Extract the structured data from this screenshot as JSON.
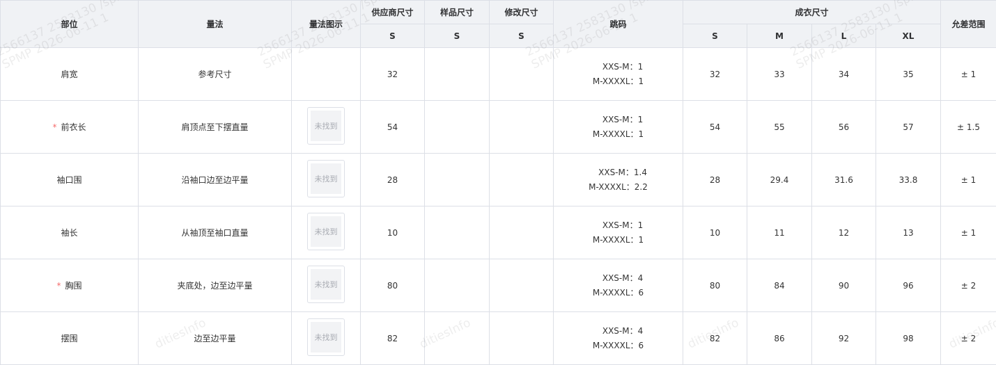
{
  "header": {
    "part": "部位",
    "method": "量法",
    "diagram": "量法图示",
    "supplier_size": "供应商尺寸",
    "sample_size": "样品尺寸",
    "modified_size": "修改尺寸",
    "supplier_sub": "S",
    "sample_sub": "S",
    "modified_sub": "S",
    "jump": "跳码",
    "garment_size": "成衣尺寸",
    "sizes": [
      "S",
      "M",
      "L",
      "XL"
    ],
    "tolerance": "允差范围"
  },
  "rows": [
    {
      "required": false,
      "part": "肩宽",
      "method": "参考尺寸",
      "image": "",
      "supplier": "32",
      "sample": "",
      "modified": "",
      "jump1": "XXS-M：1",
      "jump2": "M-XXXXL：1",
      "s": "32",
      "m": "33",
      "l": "34",
      "xl": "35",
      "tol": "± 1"
    },
    {
      "required": true,
      "part": "前衣长",
      "method": "肩顶点至下摆直量",
      "image": "未找到",
      "supplier": "54",
      "sample": "",
      "modified": "",
      "jump1": "XXS-M：1",
      "jump2": "M-XXXXL：1",
      "s": "54",
      "m": "55",
      "l": "56",
      "xl": "57",
      "tol": "± 1.5"
    },
    {
      "required": false,
      "part": "袖口围",
      "method": "沿袖口边至边平量",
      "image": "未找到",
      "supplier": "28",
      "sample": "",
      "modified": "",
      "jump1": "XXS-M：1.4",
      "jump2": "M-XXXXL：2.2",
      "s": "28",
      "m": "29.4",
      "l": "31.6",
      "xl": "33.8",
      "tol": "± 1"
    },
    {
      "required": false,
      "part": "袖长",
      "method": "从袖顶至袖口直量",
      "image": "未找到",
      "supplier": "10",
      "sample": "",
      "modified": "",
      "jump1": "XXS-M：1",
      "jump2": "M-XXXXL：1",
      "s": "10",
      "m": "11",
      "l": "12",
      "xl": "13",
      "tol": "± 1"
    },
    {
      "required": true,
      "part": "胸围",
      "method": "夹底处，边至边平量",
      "image": "未找到",
      "supplier": "80",
      "sample": "",
      "modified": "",
      "jump1": "XXS-M：4",
      "jump2": "M-XXXXL：6",
      "s": "80",
      "m": "84",
      "l": "90",
      "xl": "96",
      "tol": "± 2"
    },
    {
      "required": false,
      "part": "摆围",
      "method": "边至边平量",
      "image": "未找到",
      "supplier": "82",
      "sample": "",
      "modified": "",
      "jump1": "XXS-M：4",
      "jump2": "M-XXXXL：6",
      "s": "82",
      "m": "86",
      "l": "92",
      "xl": "98",
      "tol": "± 2"
    }
  ],
  "watermark": {
    "line1": "2566137 2583130 /spmp",
    "line2": "SPMP 2026-06-11 1",
    "footer": "ditiesInfo"
  }
}
